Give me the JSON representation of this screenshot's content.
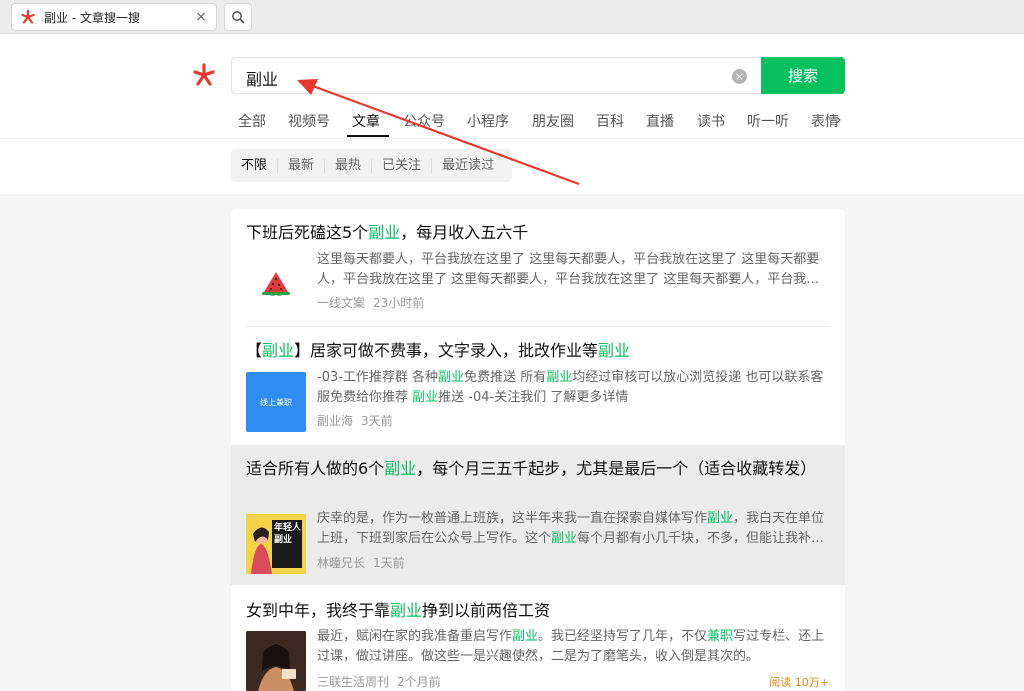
{
  "browser_tab": {
    "title": "副业 - 文章搜一搜",
    "close": "×"
  },
  "search": {
    "query": "副业",
    "button_label": "搜索",
    "clear": "×"
  },
  "categories": [
    "全部",
    "视频号",
    "文章",
    "公众号",
    "小程序",
    "朋友圈",
    "百科",
    "直播",
    "读书",
    "听一听",
    "表情"
  ],
  "active_category": "文章",
  "filters": [
    "不限",
    "最新",
    "最热",
    "已关注",
    "最近读过"
  ],
  "results": [
    {
      "title_parts": [
        "下班后死磕这5个",
        "副业",
        "，每月收入五六千"
      ],
      "snippet_parts": [
        "这里每天都要人，平台我放在这里了 这里每天都要人，平台我放在这里了 这里每天都要人，平台我放在这里了 这里每天都要人，平台我放在这里了 这里每天都要人，平台我…"
      ],
      "source": "一线文案",
      "time": "23小时前"
    },
    {
      "title_parts": [
        "【",
        "副业",
        "】居家可做不费事，文字录入，批改作业等",
        "副业"
      ],
      "snippet_parts": [
        "-03-工作推荐群 各种",
        "副业",
        "免费推送 所有",
        "副业",
        "均经过审核可以放心浏览投递 也可以联系客服免费给你推荐 ",
        "副业",
        "推送 -04-关注我们 了解更多详情"
      ],
      "thumb_text": "线上兼职",
      "source": "副业海",
      "time": "3天前"
    },
    {
      "title_parts": [
        "适合所有人做的6个",
        "副业",
        "，每个月三五千起步，尤其是最后一个（适合收藏转发）"
      ],
      "snippet_parts": [
        "庆幸的是，作为一枚普通上班族，这半年来我一直在探索自媒体写作",
        "副业",
        "，我白天在单位上班，下班到家后在公众号上写作。这个",
        "副业",
        "每个月都有小几千块，不多，但能让我补…"
      ],
      "thumb_text": "年轻人副业",
      "source": "林曈兄长",
      "time": "1天前"
    },
    {
      "title_parts": [
        "女到中年，我终于靠",
        "副业",
        "挣到以前两倍工资"
      ],
      "snippet_parts": [
        "最近，赋闲在家的我准备重启写作",
        "副业",
        "。我已经坚持写了几年，不仅",
        "兼职",
        "写过专栏、还上过课，做过讲座。做这些一是兴趣使然，二是为了磨笔头，收入倒是其次的。"
      ],
      "source": "三联生活周刊",
      "time": "2个月前",
      "reads": "阅读 10万+"
    }
  ],
  "colors": {
    "accent": "#07c160",
    "annotation_arrow": "#e8372c"
  }
}
